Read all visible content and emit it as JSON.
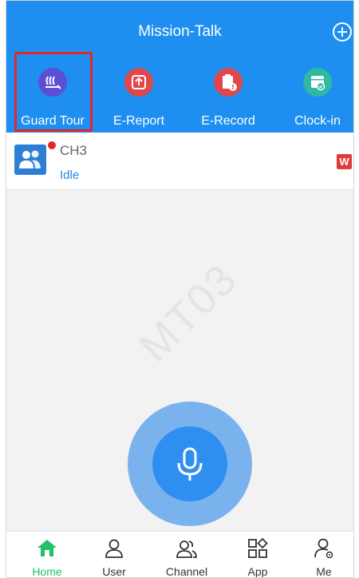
{
  "app": {
    "title": "Mission-Talk"
  },
  "shortcuts": [
    {
      "label": "Guard Tour",
      "icon": "guard-tour-icon",
      "color": "#5b4fd6"
    },
    {
      "label": "E-Report",
      "icon": "e-report-icon",
      "color": "#e0474b"
    },
    {
      "label": "E-Record",
      "icon": "e-record-icon",
      "color": "#e0474b"
    },
    {
      "label": "Clock-in",
      "icon": "clock-in-icon",
      "color": "#2fb9a0"
    }
  ],
  "channel": {
    "name": "CH3",
    "status": "Idle",
    "badge": "W"
  },
  "watermark": "MT03",
  "tabs": [
    {
      "label": "Home",
      "icon": "home-icon",
      "active": true
    },
    {
      "label": "User",
      "icon": "user-icon",
      "active": false
    },
    {
      "label": "Channel",
      "icon": "channel-icon",
      "active": false
    },
    {
      "label": "App",
      "icon": "app-icon",
      "active": false
    },
    {
      "label": "Me",
      "icon": "me-icon",
      "active": false
    }
  ],
  "colors": {
    "header": "#1e8ff0",
    "active_tab": "#20c06a",
    "highlight": "#e0272b",
    "ptt": "#2e8ff0"
  }
}
